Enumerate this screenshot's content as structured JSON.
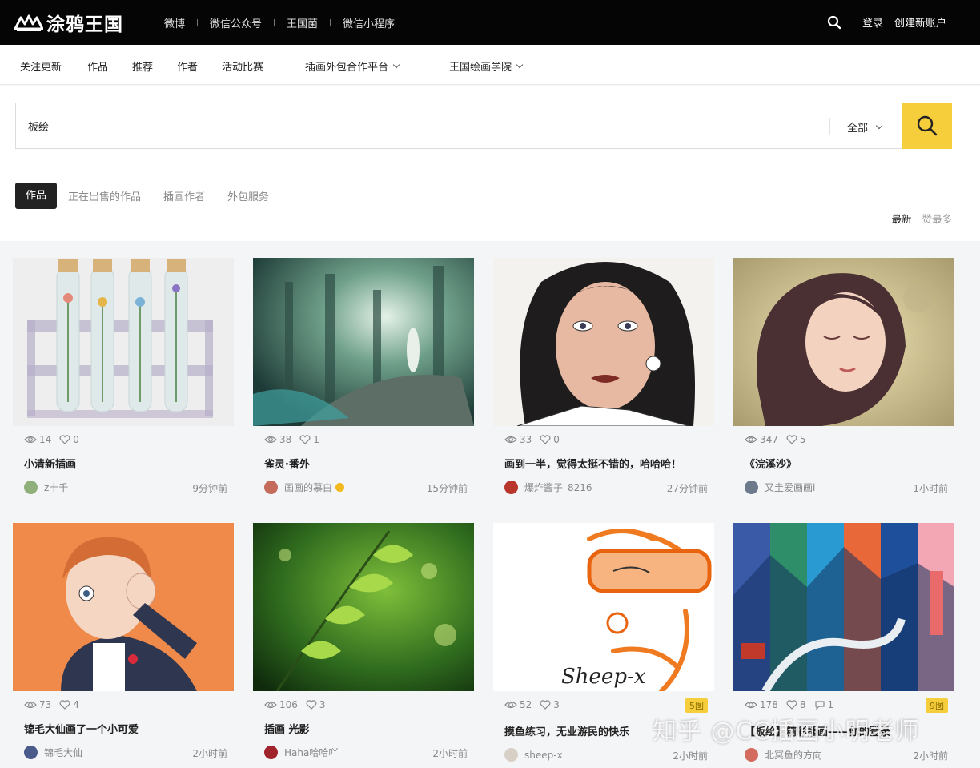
{
  "topbar": {
    "logo_text": "涂鸦王国",
    "links": [
      "微博",
      "微信公众号",
      "王国菌",
      "微信小程序"
    ],
    "login": "登录",
    "register": "创建新账户"
  },
  "subnav": {
    "items": [
      "关注更新",
      "作品",
      "推荐",
      "作者",
      "活动比赛"
    ],
    "dropdowns": [
      "插画外包合作平台",
      "王国绘画学院"
    ]
  },
  "search": {
    "value": "板绘",
    "scope": "全部"
  },
  "tabs": [
    "作品",
    "正在出售的作品",
    "插画作者",
    "外包服务"
  ],
  "sort": [
    "最新",
    "赞最多"
  ],
  "cards": [
    {
      "views": "14",
      "likes": "0",
      "title": "小清新插画",
      "author": "z十千",
      "time": "9分钟前"
    },
    {
      "views": "38",
      "likes": "1",
      "title": "雀灵·番外",
      "author": "画画的慕白",
      "time": "15分钟前",
      "verified": true
    },
    {
      "views": "33",
      "likes": "0",
      "title": "画到一半，觉得太挺不错的，哈哈哈！",
      "author": "爆炸酱子_8216",
      "time": "27分钟前"
    },
    {
      "views": "347",
      "likes": "5",
      "title": "《浣溪沙》",
      "author": "又圭爱画画i",
      "time": "1小时前"
    },
    {
      "views": "73",
      "likes": "4",
      "title": "锦毛大仙画了一个小可爱",
      "author": "锦毛大仙",
      "time": "2小时前"
    },
    {
      "views": "106",
      "likes": "3",
      "title": "插画 光影",
      "author": "Haha哈哈吖",
      "time": "2小时前"
    },
    {
      "views": "52",
      "likes": "3",
      "title": "摸鱼练习，无业游民的快乐",
      "author": "sheep-x",
      "time": "2小时前",
      "badge": "5图"
    },
    {
      "views": "178",
      "likes": "8",
      "comments": "1",
      "title": "【板绘】精彩插画——你的登录",
      "author": "北冥鱼的方向",
      "time": "2小时前",
      "badge": "9图"
    }
  ],
  "watermark": "知乎 @CC插画小明老师",
  "colors": {
    "accent": "#f6cd3b",
    "topbar": "#050505"
  }
}
